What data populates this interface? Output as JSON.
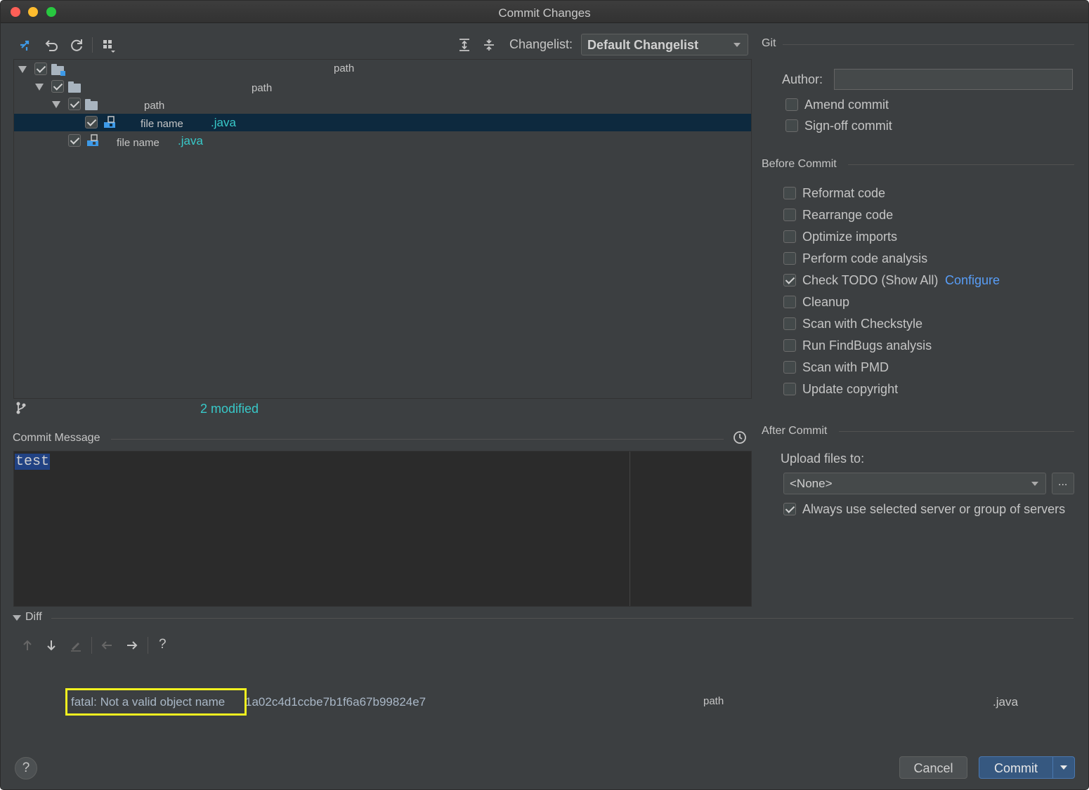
{
  "window": {
    "title": "Commit Changes"
  },
  "toolbar": {
    "changelist_label": "Changelist:",
    "changelist_value": "Default Changelist",
    "icons": [
      "show-diff-icon",
      "rollback-icon",
      "refresh-icon",
      "group-by-icon",
      "expand-all-icon",
      "collapse-all-icon"
    ]
  },
  "tree": {
    "rows": [
      {
        "label": "path"
      },
      {
        "label": "path"
      },
      {
        "label": "path"
      },
      {
        "name": "file name",
        "ext": ".java"
      },
      {
        "name": "file name",
        "ext": ".java"
      }
    ],
    "status": "2 modified"
  },
  "commit_message": {
    "label": "Commit Message",
    "value": "test"
  },
  "git": {
    "section": "Git",
    "author_label": "Author:",
    "author_value": "",
    "amend": "Amend commit",
    "signoff": "Sign-off commit"
  },
  "before_commit": {
    "section": "Before Commit",
    "options": [
      {
        "label": "Reformat code",
        "checked": false
      },
      {
        "label": "Rearrange code",
        "checked": false
      },
      {
        "label": "Optimize imports",
        "checked": false
      },
      {
        "label": "Perform code analysis",
        "checked": false
      },
      {
        "label": "Check TODO (Show All)",
        "checked": true,
        "link": "Configure"
      },
      {
        "label": "Cleanup",
        "checked": false
      },
      {
        "label": "Scan with Checkstyle",
        "checked": false
      },
      {
        "label": "Run FindBugs analysis",
        "checked": false
      },
      {
        "label": "Scan with PMD",
        "checked": false
      },
      {
        "label": "Update copyright",
        "checked": false
      }
    ]
  },
  "after_commit": {
    "section": "After Commit",
    "upload_label": "Upload files to:",
    "upload_value": "<None>",
    "browse": "...",
    "always_use": "Always use selected server or group of servers"
  },
  "diff": {
    "label": "Diff",
    "help": "?",
    "error": "fatal: Not a valid object name",
    "hash": "1a02c4d1ccbe7b1f6a67b99824e7",
    "path": "path",
    "ext": ".java"
  },
  "footer": {
    "help": "?",
    "cancel": "Cancel",
    "commit": "Commit"
  },
  "colors": {
    "background": "#3c3f41",
    "selection": "#0d293e",
    "accent_link": "#589df6",
    "modified_text": "#38c9c9",
    "primary_button": "#365880",
    "highlight": "#f1f11f"
  }
}
